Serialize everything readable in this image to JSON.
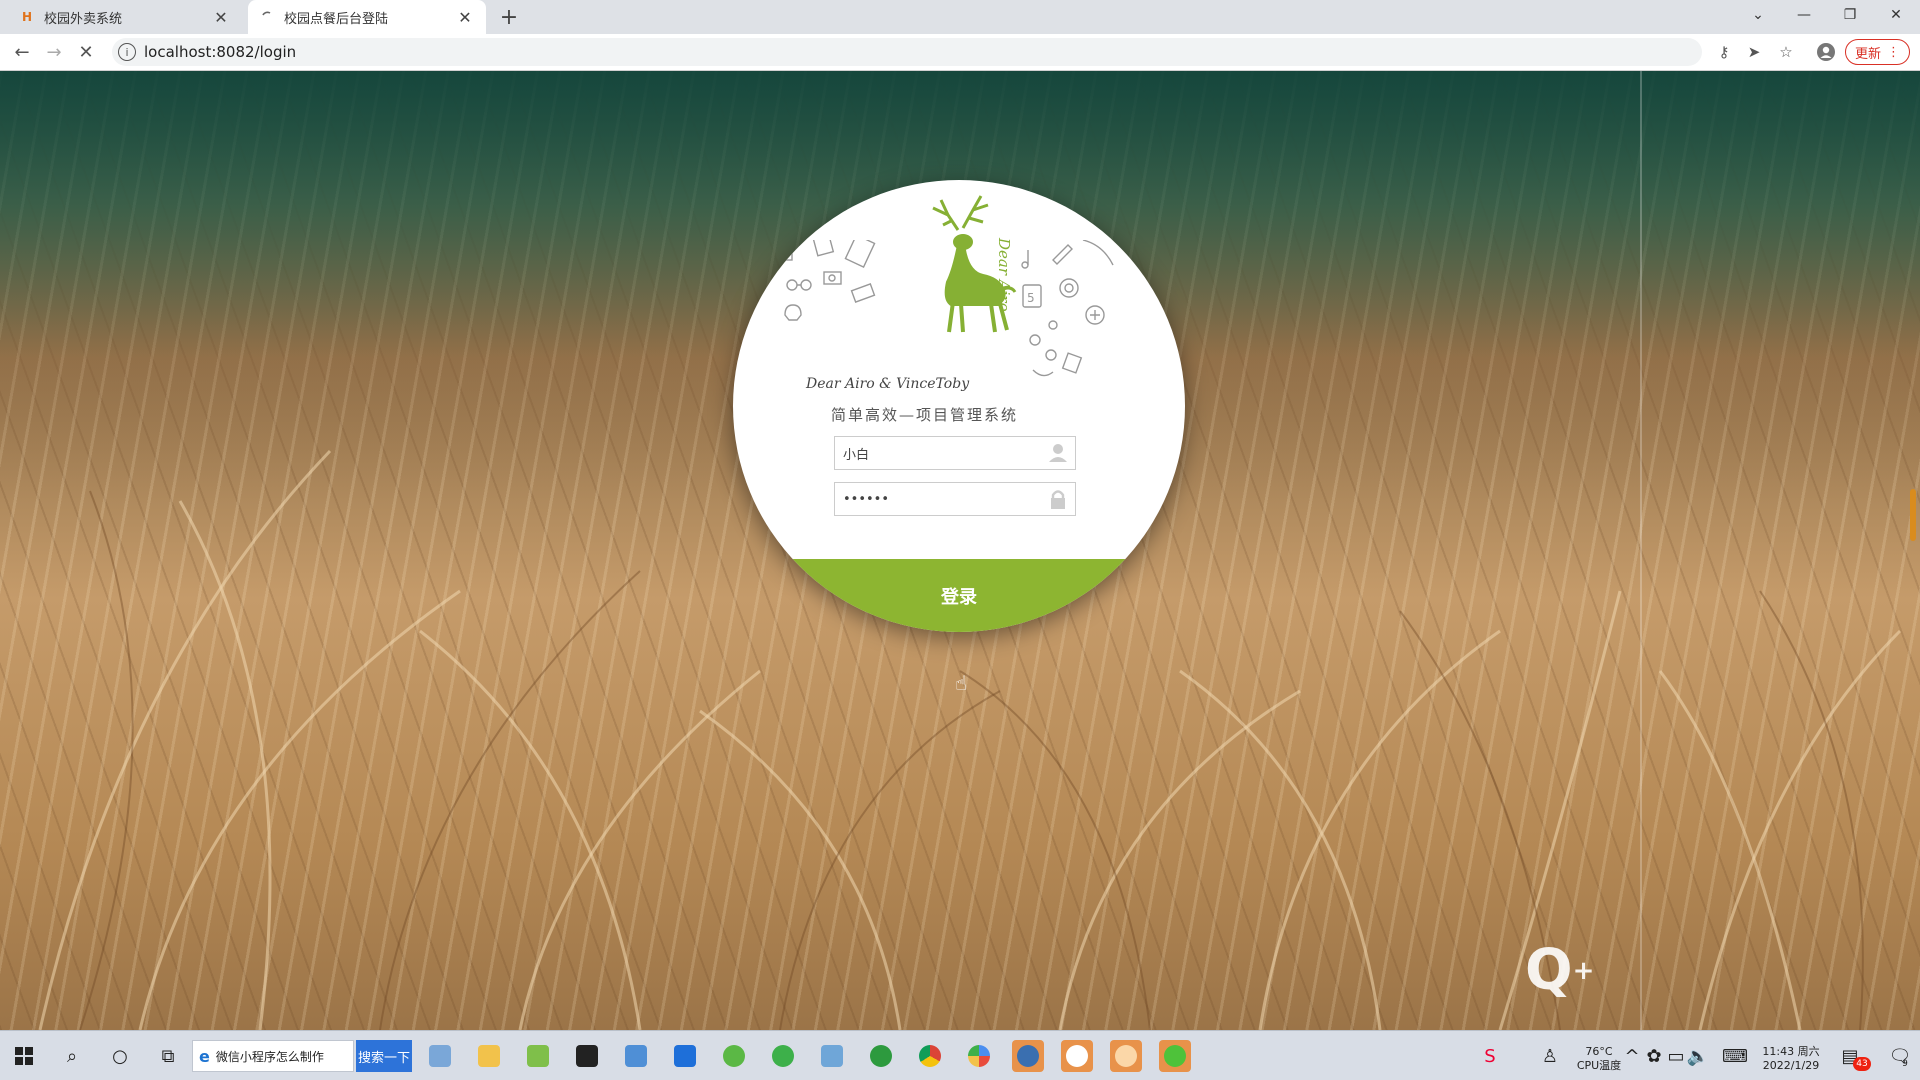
{
  "browser": {
    "tabs": [
      {
        "title": "校园外卖系统",
        "favicon": "H",
        "active": false
      },
      {
        "title": "校园点餐后台登陆",
        "favicon": "",
        "active": true
      }
    ],
    "url": "localhost:8082/login",
    "update_label": "更新",
    "new_tab": "+"
  },
  "login": {
    "brand_vertical": "Dear Airo",
    "tagline": "Dear Airo & VinceToby",
    "slogan": "简单高效—项目管理系统",
    "username_value": "小白",
    "password_value": "••••••",
    "submit_label": "登录"
  },
  "taskbar": {
    "search_text": "微信小程序怎么制作",
    "search_button": "搜索一下",
    "temperature": "76°C",
    "temperature_label": "CPU温度",
    "time": "11:43 周六",
    "date": "2022/1/29",
    "notification_count": "43",
    "notify_count_small": "9"
  },
  "colors": {
    "accent_green": "#8db531",
    "deer_green": "#86b034",
    "update_red": "#d93025",
    "taskbar_search_blue": "#2d73d9"
  }
}
